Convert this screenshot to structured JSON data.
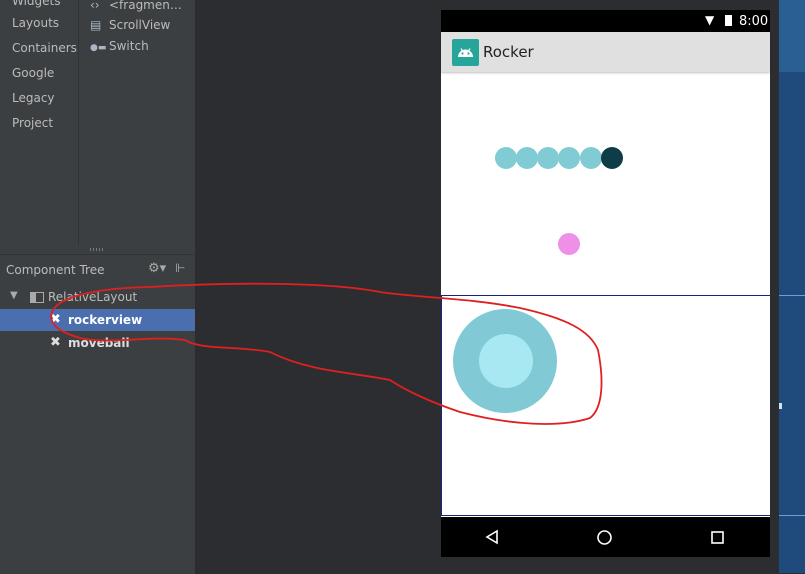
{
  "palette": {
    "categories": [
      "Widgets",
      "Layouts",
      "Containers",
      "Google",
      "Legacy",
      "Project"
    ],
    "widgets": [
      {
        "icon": "fragment-icon",
        "glyph": "‹›",
        "label": "<fragmen…"
      },
      {
        "icon": "scrollview-icon",
        "glyph": "▤",
        "label": "ScrollView"
      },
      {
        "icon": "switch-icon",
        "glyph": "●▬",
        "label": "Switch"
      }
    ]
  },
  "component_tree": {
    "title": "Component Tree",
    "root": "RelativeLayout",
    "children": [
      "rockerview",
      "moveball"
    ],
    "selected": "rockerview"
  },
  "device": {
    "status_time": "8:00",
    "app_title": "Rocker",
    "colors": {
      "snake_body": "#80cbd4",
      "snake_head": "#0e3d47",
      "food_ball": "#ee8fe8",
      "rocker_outer": "#80c9d5",
      "rocker_inner": "#a8e8f2",
      "annotation_stroke": "#e02020"
    }
  }
}
